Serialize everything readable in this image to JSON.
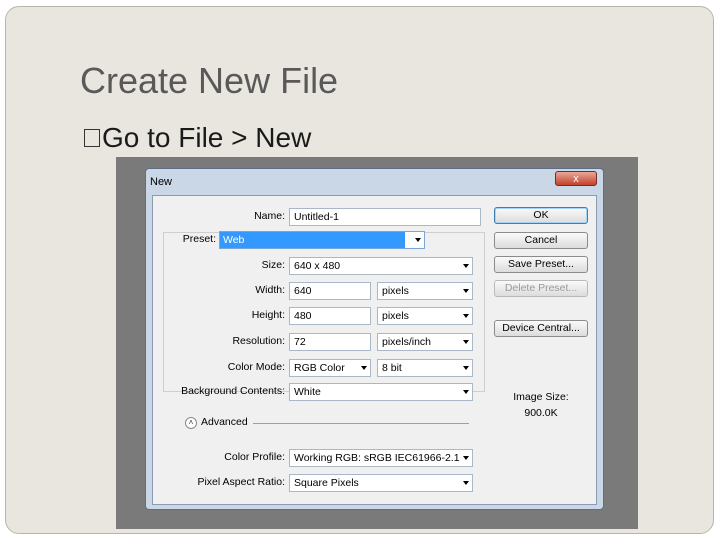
{
  "slide": {
    "title": "Create New File",
    "bullet": "Go to File > New"
  },
  "dialog": {
    "title": "New",
    "close_label": "x",
    "fields": {
      "name": {
        "label": "Name:",
        "value": "Untitled-1"
      },
      "preset": {
        "label": "Preset:",
        "value": "Web"
      },
      "size": {
        "label": "Size:",
        "value": "640 x 480"
      },
      "width": {
        "label": "Width:",
        "value": "640",
        "unit": "pixels"
      },
      "height": {
        "label": "Height:",
        "value": "480",
        "unit": "pixels"
      },
      "resolution": {
        "label": "Resolution:",
        "value": "72",
        "unit": "pixels/inch"
      },
      "color_mode": {
        "label": "Color Mode:",
        "value": "RGB Color",
        "depth": "8 bit"
      },
      "background": {
        "label": "Background Contents:",
        "value": "White"
      },
      "advanced": {
        "label": "Advanced"
      },
      "color_profile": {
        "label": "Color Profile:",
        "value": "Working RGB: sRGB IEC61966-2.1"
      },
      "pixel_aspect": {
        "label": "Pixel Aspect Ratio:",
        "value": "Square Pixels"
      }
    },
    "buttons": {
      "ok": "OK",
      "cancel": "Cancel",
      "save_preset": "Save Preset...",
      "delete_preset": "Delete Preset...",
      "device_central": "Device Central..."
    },
    "image_size": {
      "label": "Image Size:",
      "value": "900.0K"
    }
  },
  "colors": {
    "slide_bg": "#e9e6df",
    "dialog_frame": "#c9d7e6",
    "selection": "#3399ff"
  }
}
